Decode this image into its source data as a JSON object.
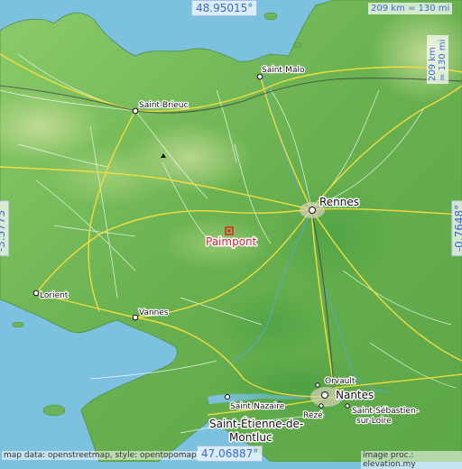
{
  "map": {
    "place_name": "Paimpont",
    "coords": {
      "top": "48.95015°",
      "bottom": "47.06887°",
      "left": "-3.5773°",
      "right": "-0.7648°"
    },
    "scale": {
      "horizontal": "209 km = 130 mi",
      "vertical": "209 km = 130 mi"
    },
    "credits": {
      "left": "map data: openstreetmap, style: opentopomap",
      "right": "image proc.: elevation.my"
    },
    "cities": {
      "rennes": "Rennes",
      "saint_malo": "Saint-Malo",
      "saint_brieuc": "Saint-Brieuc",
      "lorient": "Lorient",
      "vannes": "Vannes",
      "saint_nazaire": "Saint-Nazaire",
      "saint_etienne_1": "Saint-Étienne-de-",
      "saint_etienne_2": "Montluc",
      "nantes": "Nantes",
      "orvault": "Orvault",
      "reze": "Rezé",
      "saint_sebastien_1": "Saint-Sébastien-",
      "saint_sebastien_2": "sur-Loire"
    },
    "colors": {
      "sea": "#7cc1e0",
      "land": "#6fb85a",
      "highlight": "#e0202a",
      "coord_text": "#3c68d8"
    }
  }
}
